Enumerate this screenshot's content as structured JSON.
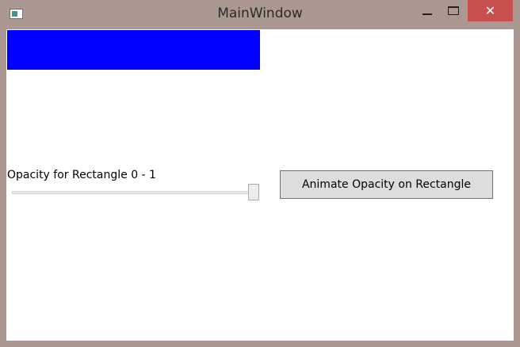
{
  "window": {
    "title": "MainWindow",
    "icon": "app-window-icon",
    "controls": {
      "minimize_icon": "minimize-icon",
      "maximize_icon": "maximize-icon",
      "close_icon": "close-icon",
      "close_glyph": "✕"
    },
    "colors": {
      "frame": "#ab9893",
      "close": "#c7504f"
    }
  },
  "content": {
    "rectangle": {
      "color": "#0000ff",
      "opacity": 1
    },
    "slider": {
      "label": "Opacity for Rectangle 0 - 1",
      "min": 0,
      "max": 1,
      "value": 1
    },
    "animate_button": {
      "label": "Animate Opacity on Rectangle"
    }
  }
}
